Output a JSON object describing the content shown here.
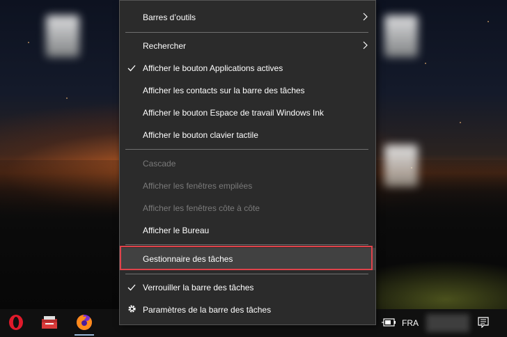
{
  "menu": {
    "items": [
      {
        "label": "Barres d’outils",
        "submenu": true
      },
      {
        "label": "Rechercher",
        "submenu": true
      },
      {
        "label": "Afficher le bouton Applications actives",
        "checked": true
      },
      {
        "label": "Afficher les contacts sur la barre des tâches"
      },
      {
        "label": "Afficher le bouton Espace de travail Windows Ink"
      },
      {
        "label": "Afficher le bouton clavier tactile"
      },
      {
        "label": "Cascade",
        "disabled": true
      },
      {
        "label": "Afficher les fenêtres empilées",
        "disabled": true
      },
      {
        "label": "Afficher les fenêtres côte à côte",
        "disabled": true
      },
      {
        "label": "Afficher le Bureau"
      },
      {
        "label": "Gestionnaire des tâches",
        "highlighted": true
      },
      {
        "label": "Verrouiller la barre des tâches",
        "checked": true
      },
      {
        "label": "Paramètres de la barre des tâches",
        "icon": "gear-icon"
      }
    ],
    "highlight_color": "#e0424a"
  },
  "taskbar": {
    "apps": [
      {
        "icon": "opera-icon"
      },
      {
        "icon": "toolbox-icon"
      },
      {
        "icon": "firefox-icon",
        "active": true
      }
    ],
    "tray": {
      "icons": [
        "battery-icon",
        "notification-icon"
      ],
      "language": "FRA"
    }
  }
}
